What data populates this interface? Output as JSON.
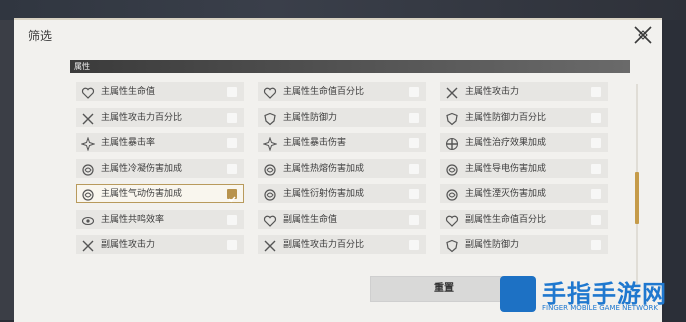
{
  "dialog": {
    "title": "筛选",
    "close_icon": "close-x-icon"
  },
  "section": {
    "label": "属性"
  },
  "options": [
    {
      "label": "主属性生命值",
      "icon": "heart-icon",
      "checked": false
    },
    {
      "label": "主属性生命值百分比",
      "icon": "heart-percent-icon",
      "checked": false
    },
    {
      "label": "主属性攻击力",
      "icon": "swords-icon",
      "checked": false
    },
    {
      "label": "主属性攻击力百分比",
      "icon": "swords-percent-icon",
      "checked": false
    },
    {
      "label": "主属性防御力",
      "icon": "shield-icon",
      "checked": false
    },
    {
      "label": "主属性防御力百分比",
      "icon": "shield-percent-icon",
      "checked": false
    },
    {
      "label": "主属性暴击率",
      "icon": "crit-rate-icon",
      "checked": false
    },
    {
      "label": "主属性暴击伤害",
      "icon": "crit-damage-icon",
      "checked": false
    },
    {
      "label": "主属性治疗效果加成",
      "icon": "healing-icon",
      "checked": false
    },
    {
      "label": "主属性冷凝伤害加成",
      "icon": "glacio-icon",
      "checked": false
    },
    {
      "label": "主属性热熔伤害加成",
      "icon": "fusion-icon",
      "checked": false
    },
    {
      "label": "主属性导电伤害加成",
      "icon": "electro-icon",
      "checked": false
    },
    {
      "label": "主属性气动伤害加成",
      "icon": "aero-icon",
      "checked": true
    },
    {
      "label": "主属性衍射伤害加成",
      "icon": "spectro-icon",
      "checked": false
    },
    {
      "label": "主属性湮灭伤害加成",
      "icon": "havoc-icon",
      "checked": false
    },
    {
      "label": "主属性共鸣效率",
      "icon": "resonance-eye-icon",
      "checked": false
    },
    {
      "label": "副属性生命值",
      "icon": "heart-icon",
      "checked": false
    },
    {
      "label": "副属性生命值百分比",
      "icon": "heart-percent-icon",
      "checked": false
    },
    {
      "label": "副属性攻击力",
      "icon": "swords-icon",
      "checked": false
    },
    {
      "label": "副属性攻击力百分比",
      "icon": "swords-percent-icon",
      "checked": false
    },
    {
      "label": "副属性防御力",
      "icon": "shield-icon",
      "checked": false
    }
  ],
  "reset_button": {
    "label": "重置"
  },
  "watermark": {
    "name": "手指手游网",
    "subtitle": "FINGER MOBILE GAME NETWORK"
  },
  "colors": {
    "accent": "#b8934d",
    "cell_bg": "#e7e6e3",
    "panel_bg": "#f2f1ee"
  }
}
